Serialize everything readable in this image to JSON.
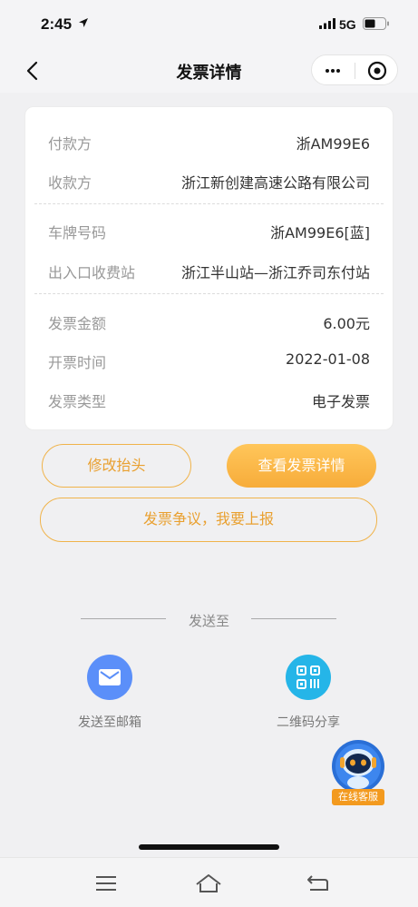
{
  "status_bar": {
    "time": "2:45",
    "network": "5G"
  },
  "nav": {
    "title": "发票详情"
  },
  "invoice": {
    "payer_label": "付款方",
    "payer_value": "浙AM99E6",
    "payee_label": "收款方",
    "payee_value": "浙江新创建高速公路有限公司",
    "plate_label": "车牌号码",
    "plate_value": "浙AM99E6[蓝]",
    "station_label": "出入口收费站",
    "station_value": "浙江半山站—浙江乔司东付站",
    "amount_label": "发票金额",
    "amount_value": "6.00元",
    "time_label": "开票时间",
    "time_value": "2022-01-08",
    "type_label": "发票类型",
    "type_value": "电子发票"
  },
  "actions": {
    "modify_header": "修改抬头",
    "view_details": "查看发票详情",
    "dispute": "发票争议，我要上报"
  },
  "send": {
    "title": "发送至",
    "email_label": "发送至邮箱",
    "qr_label": "二维码分享"
  },
  "support": {
    "label": "在线客服"
  },
  "colors": {
    "accent": "#f7ac3a",
    "email_blue": "#5b8ff9",
    "qr_cyan": "#25b5e8"
  }
}
